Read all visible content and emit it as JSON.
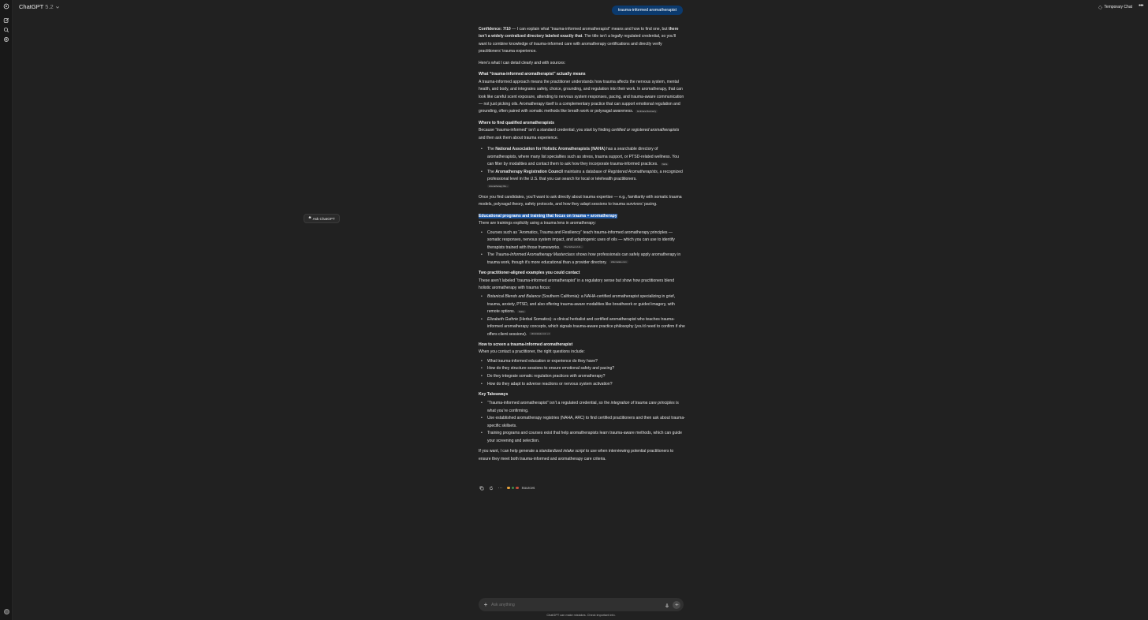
{
  "header": {
    "app_name": "ChatGPT",
    "model_version": "5.2",
    "temporary_chat": "Temporary Chat"
  },
  "user_message": "trauma-informed aromatherapist",
  "floating": {
    "ask_label": "Ask ChatGPT"
  },
  "answer": {
    "intro": {
      "p1_a": "Confidence: 7/10",
      "p1_b": " — I can explain what “trauma-informed aromatherapist” means and how to find one, but ",
      "p1_c": "there isn’t a widely centralized directory labeled exactly that",
      "p1_d": ". The title isn’t a legally regulated credential, so you’ll want to combine knowledge of trauma-informed care with aromatherapy certifications and directly verify practitioners’ trauma experience.",
      "p2": "Here’s what I can detail clearly and with sources:"
    },
    "s1": {
      "heading": "What “trauma-informed aromatherapist” actually means",
      "body": "A trauma-informed approach means the practitioner understands how trauma affects the nervous system, mental health, and body, and integrates safety, choice, grounding, and regulation into their work. In aromatherapy, that can look like careful scent exposure, attending to nervous system responses, pacing, and trauma-aware communication — not just picking oils. Aromatherapy itself is a complementary practice that can support emotional regulation and grounding, often paired with somatic methods like breath work or polyvagal awareness.",
      "chip": "Embrace Recovery"
    },
    "s2": {
      "heading": "Where to find qualified aromatherapists",
      "body_a": "Because “trauma-informed” isn’t a standard credential, you start by finding ",
      "body_b": "certified or registered aromatherapists",
      "body_c": " and then ask them about trauma experience.",
      "li1_a": "The ",
      "li1_b": "National Association for Holistic Aromatherapists (NAHA)",
      "li1_c": " has a searchable directory of aromatherapists, where many list specialties such as stress, trauma support, or PTSD-related wellness. You can filter by modalities and contact them to ask how they incorporate trauma-informed practices.",
      "li1_chip": "Naha",
      "li2_a": "The ",
      "li2_b": "Aromatherapy Registration Council",
      "li2_c": " maintains a database of ",
      "li2_d": "Registered Aromatherapists",
      "li2_e": ", a recognized professional level in the U.S. that you can search for local or telehealth practitioners.",
      "li2_chip": "Aromatherapy Re...",
      "after": "Once you find candidates, you’ll want to ask directly about trauma expertise — e.g., familiarity with somatic trauma models, polyvagal theory, safety protocols, and how they adapt sessions to trauma survivors’ pacing."
    },
    "s3": {
      "heading": "Educational programs and training that focus on trauma + aromatherapy",
      "body": "There are trainings explicitly using a trauma lens in aromatherapy:",
      "li1": "Courses such as “Aromatics, Trauma and Resiliency” teach trauma-informed aromatherapy principles — somatic responses, nervous system impact, and adaptogenic uses of oils — which you can use to identify therapists trained with those frameworks.",
      "li1_chip": "The School of Ar...",
      "li2_a": "The ",
      "li2_b": "Trauma-Informed Aromatherapy Masterclass",
      "li2_c": " shows how professionals can safely apply aromatherapy in trauma work, though it’s more educational than a provider directory.",
      "li2_chip": "stfannatale.com"
    },
    "s4": {
      "heading": "Two practitioner-aligned examples you could contact",
      "body": "These aren’t labeled “trauma-informed aromatherapist” in a regulatory sense but show how practitioners blend holistic aromatherapy with trauma focus:",
      "li1_a": "Botanical Blends and Balance",
      "li1_b": " (Southern California): a NAHA-certified aromatherapist specializing in grief, trauma, anxiety, PTSD, and also offering trauma-aware modalities like breathwork or guided imagery, with remote options.",
      "li1_chip": "Naha",
      "li2_a": "Elizabeth Guthrie",
      "li2_b": " (Herbal Somatics): a clinical herbalist and certified aromatherapist who teaches trauma-informed aromatherapy concepts, which signals trauma-aware practice philosophy (you’d need to confirm if she offers client sessions).",
      "li2_chip": "stfannatale.com +1"
    },
    "s5": {
      "heading": "How to screen a trauma-informed aromatherapist",
      "body": "When you contact a practitioner, the right questions include:",
      "q1": "What trauma-informed education or experience do they have?",
      "q2": "How do they structure sessions to ensure emotional safety and pacing?",
      "q3": "Do they integrate somatic regulation practices with aromatherapy?",
      "q4": "How do they adapt to adverse reactions or nervous system activation?"
    },
    "s6": {
      "heading": "Key Takeaways",
      "li1_a": "“Trauma-informed aromatherapist” isn’t a regulated credential, so the ",
      "li1_b": "integration of trauma care principles",
      "li1_c": " is what you’re confirming.",
      "li2": "Use established aromatherapy registries (NAHA, ARC) to find certified practitioners and then ask about trauma-specific skillsets.",
      "li3": "Training programs and courses exist that help aromatherapists learn trauma-aware methods, which can guide your screening and selection."
    },
    "closing_a": "If you want, I can help generate a ",
    "closing_b": "standardized intake script",
    "closing_c": " to use when interviewing potential practitioners to ensure they meet both trauma-informed and aromatherapy care criteria."
  },
  "actions": {
    "sources_label": "Sources",
    "source_colors": [
      "#e8a33d",
      "#3c8b4a",
      "#c24f3a"
    ]
  },
  "composer": {
    "placeholder": "Ask anything",
    "disclaimer": "ChatGPT can make mistakes. Check important info."
  },
  "colors": {
    "background": "#212121",
    "user_bubble": "#0b3a6e",
    "highlight": "#1f5aa8"
  }
}
